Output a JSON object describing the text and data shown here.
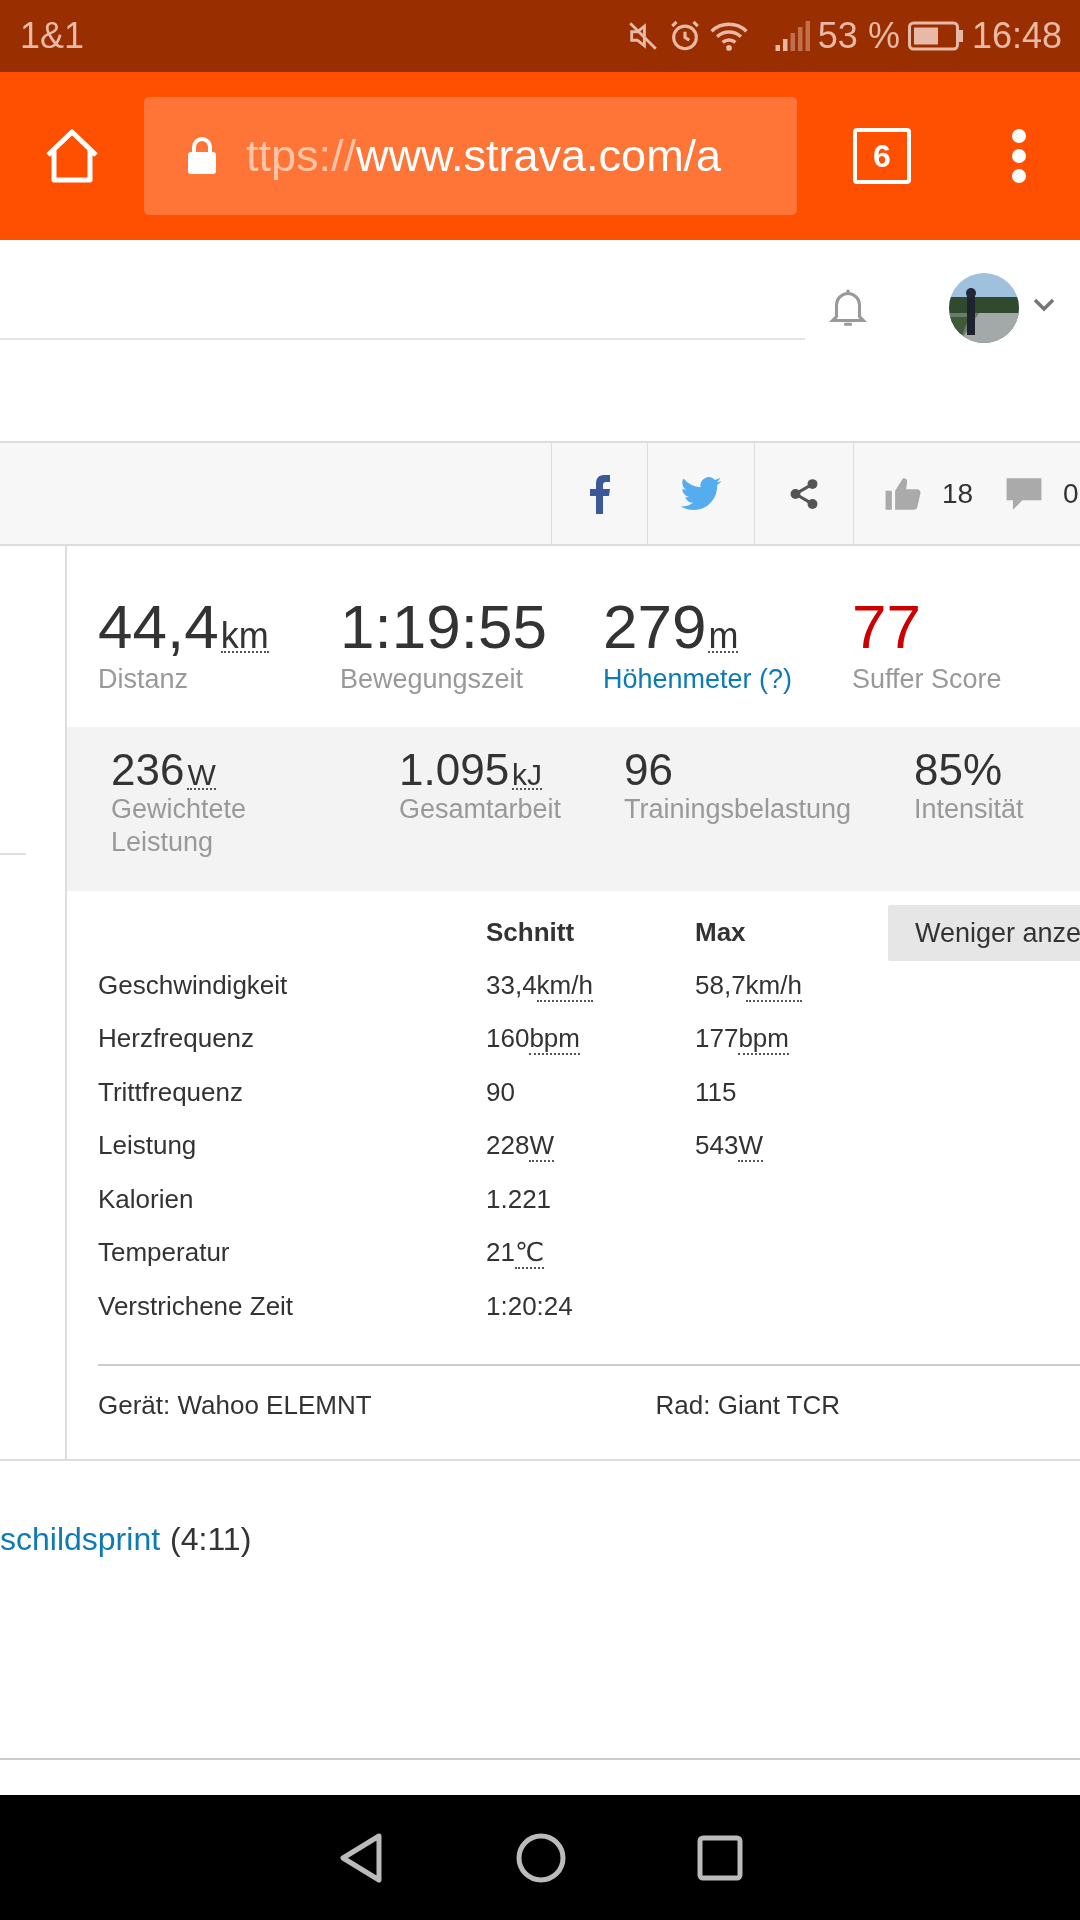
{
  "status_bar": {
    "carrier": "1&1",
    "battery": "53 %",
    "time": "16:48"
  },
  "browser": {
    "url_scheme": "ttps://",
    "url_host": "www.strava.com/a",
    "tab_count": "6"
  },
  "actions": {
    "kudos": "18",
    "comments": "0"
  },
  "stats": [
    {
      "value": "44,4",
      "unit": "km",
      "label": "Distanz",
      "kind": "plain"
    },
    {
      "value": "1:19:55",
      "label": "Bewegungszeit",
      "kind": "plain"
    },
    {
      "value": "279",
      "unit": "m",
      "label": "Höhenmeter (?)",
      "kind": "elevation"
    },
    {
      "value": "77",
      "label": "Suffer Score",
      "kind": "score"
    }
  ],
  "secondary_stats": [
    {
      "value": "236",
      "unit": "W",
      "label": "Gewichtete Leistung"
    },
    {
      "value": "1.095",
      "unit": "kJ",
      "label": "Gesamtarbeit"
    },
    {
      "value": "96",
      "label": "Trainingsbelastung"
    },
    {
      "value": "85%",
      "label": "Intensität"
    }
  ],
  "details": {
    "columns": [
      "Schnitt",
      "Max"
    ],
    "toggle": "Weniger anze",
    "rows": [
      {
        "label": "Geschwindigkeit",
        "avg": "33,4",
        "avg_unit": "km/h",
        "max": "58,7",
        "max_unit": "km/h"
      },
      {
        "label": "Herzfrequenz",
        "avg": "160",
        "avg_unit": "bpm",
        "max": "177",
        "max_unit": "bpm"
      },
      {
        "label": "Trittfrequenz",
        "avg": "90",
        "max": "115"
      },
      {
        "label": "Leistung",
        "avg": "228",
        "avg_unit": "W",
        "max": "543",
        "max_unit": "W"
      },
      {
        "label": "Kalorien",
        "avg": "1.221"
      },
      {
        "label": "Temperatur",
        "avg": "21",
        "avg_unit": "℃"
      },
      {
        "label": "Verstrichene Zeit",
        "avg": "1:20:24"
      }
    ]
  },
  "device": "Gerät: Wahoo ELEMNT",
  "bike": "Rad: Giant TCR",
  "segment": {
    "name": "schildsprint",
    "time": "(4:11)"
  }
}
